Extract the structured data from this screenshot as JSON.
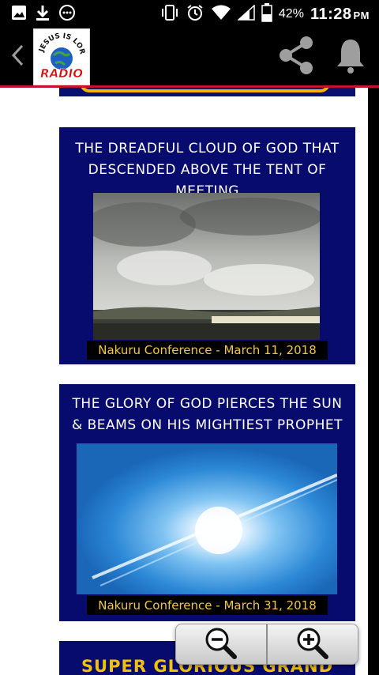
{
  "status_bar": {
    "battery_percent": "42%",
    "time": "11:28",
    "ampm": "PM",
    "icons": [
      "image-icon",
      "download-icon",
      "more-dots-icon",
      "vibrate-icon",
      "alarm-icon",
      "wifi-icon",
      "signal-icon",
      "battery-icon"
    ]
  },
  "app_bar": {
    "logo_top_text": "JESUS IS LORD",
    "logo_bottom_text": "RADIO",
    "actions": [
      "share-icon",
      "bell-icon"
    ]
  },
  "posts": [
    {
      "title_line1": "THE DREADFUL CLOUD OF GOD THAT",
      "title_line2": "DESCENDED ABOVE THE TENT OF MEETING",
      "caption": "Nakuru Conference - March 11, 2018"
    },
    {
      "title_line1": "THE GLORY OF GOD PIERCES THE SUN",
      "title_line2": "& BEAMS ON HIS MIGHTIEST PROPHET",
      "caption": "Nakuru Conference - March 31, 2018"
    },
    {
      "title_line1": "SUPER GLORIOUS GRAND"
    }
  ],
  "colors": {
    "card_background": "#070b6e",
    "caption_text": "#f0c64a",
    "accent_gold": "#f2b400",
    "app_bar_underline": "#c8102e"
  }
}
